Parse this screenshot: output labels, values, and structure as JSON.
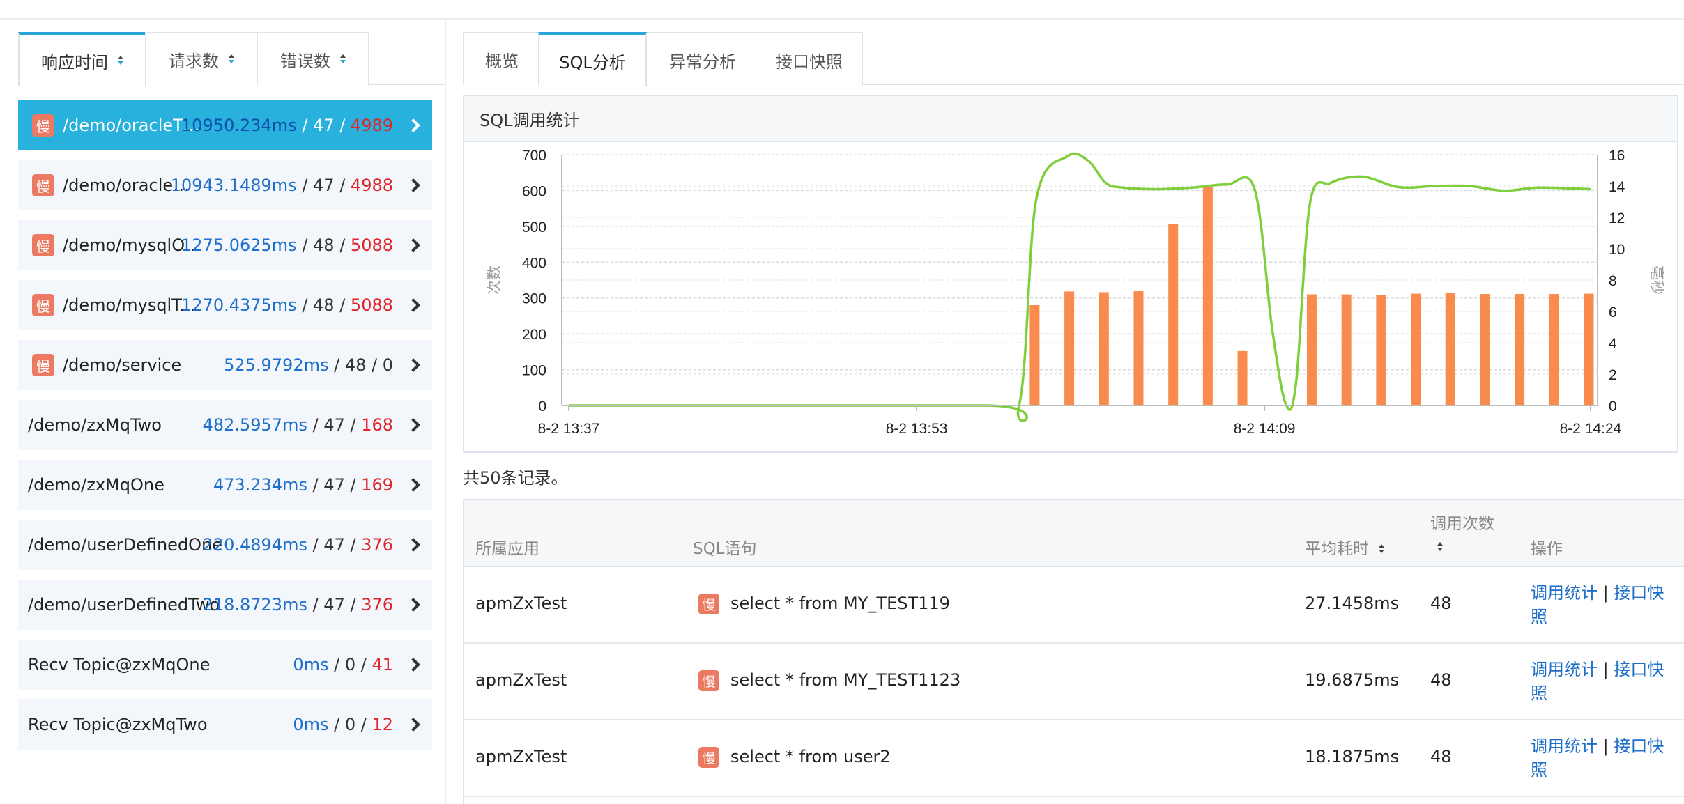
{
  "left_tabs": [
    {
      "label": "响应时间",
      "active": true
    },
    {
      "label": "请求数",
      "active": false
    },
    {
      "label": "错误数",
      "active": false
    }
  ],
  "slow_badge": "慢",
  "endpoints": [
    {
      "name": "/demo/oracleT…",
      "ms": "10950.234ms",
      "count": "47",
      "errors": "4989",
      "slow": true,
      "active": true
    },
    {
      "name": "/demo/oracle…",
      "ms": "10943.1489ms",
      "count": "47",
      "errors": "4988",
      "slow": true,
      "active": false
    },
    {
      "name": "/demo/mysqlO…",
      "ms": "1275.0625ms",
      "count": "48",
      "errors": "5088",
      "slow": true,
      "active": false
    },
    {
      "name": "/demo/mysqlTwo",
      "ms": "1270.4375ms",
      "count": "48",
      "errors": "5088",
      "slow": true,
      "active": false
    },
    {
      "name": "/demo/service",
      "ms": "525.9792ms",
      "count": "48",
      "errors": "0",
      "slow": true,
      "active": false
    },
    {
      "name": "/demo/zxMqTwo",
      "ms": "482.5957ms",
      "count": "47",
      "errors": "168",
      "slow": false,
      "active": false
    },
    {
      "name": "/demo/zxMqOne",
      "ms": "473.234ms",
      "count": "47",
      "errors": "169",
      "slow": false,
      "active": false
    },
    {
      "name": "/demo/userDefinedOne",
      "ms": "220.4894ms",
      "count": "47",
      "errors": "376",
      "slow": false,
      "active": false
    },
    {
      "name": "/demo/userDefinedTwo",
      "ms": "218.8723ms",
      "count": "47",
      "errors": "376",
      "slow": false,
      "active": false
    },
    {
      "name": "Recv Topic@zxMqOne",
      "ms": "0ms",
      "count": "0",
      "errors": "41",
      "slow": false,
      "active": false
    },
    {
      "name": "Recv Topic@zxMqTwo",
      "ms": "0ms",
      "count": "0",
      "errors": "12",
      "slow": false,
      "active": false
    }
  ],
  "right_tabs": [
    {
      "label": "概览",
      "active": false
    },
    {
      "label": "SQL分析",
      "active": true
    },
    {
      "label": "异常分析",
      "active": false
    },
    {
      "label": "接口快照",
      "active": false
    }
  ],
  "chart_panel_title": "SQL调用统计",
  "chart_data": {
    "type": "bar",
    "title": "SQL调用统计",
    "ylabel": "次数",
    "y2label": "毫秒",
    "ylim": [
      0,
      700
    ],
    "y2lim": [
      0,
      16
    ],
    "yticks": [
      0,
      100,
      200,
      300,
      400,
      500,
      600,
      700
    ],
    "y2ticks": [
      0,
      2,
      4,
      6,
      8,
      10,
      12,
      14,
      16
    ],
    "xtick_labels": [
      "8-2 13:37",
      "8-2 13:53",
      "8-2 14:09",
      "8-2 14:24"
    ],
    "grid": true,
    "bar_series": {
      "axis": "left",
      "color": "#f98b4e",
      "x_minutes": [
        13.45,
        14.45,
        15.45,
        16.45,
        17.45,
        18.45,
        19.45,
        21.45,
        22.45,
        23.45,
        24.45,
        25.45,
        26.45,
        27.45,
        28.45,
        29.45
      ],
      "values": [
        280,
        318,
        316,
        320,
        507,
        610,
        152,
        310,
        310,
        308,
        312,
        315,
        311,
        311,
        311,
        312
      ]
    },
    "line_series": {
      "axis": "right",
      "color": "#7fcf3d",
      "x_minutes": [
        0,
        12,
        13.0,
        13.5,
        14.4,
        15.0,
        15.5,
        16.0,
        17.0,
        18.0,
        19.0,
        19.8,
        20.3,
        20.7,
        21.0,
        21.4,
        22.0,
        22.9,
        23.8,
        24.3,
        25.0,
        26.0,
        27.0,
        28.0,
        29.5
      ],
      "values": [
        0,
        0,
        0,
        13.2,
        15.9,
        15.6,
        14.2,
        13.9,
        13.8,
        13.9,
        14.1,
        13.8,
        5.0,
        0.1,
        1.5,
        12.9,
        14.2,
        14.6,
        14.0,
        13.9,
        14.0,
        14.0,
        13.7,
        13.9,
        13.8
      ]
    }
  },
  "total_text": "共50条记录。",
  "table": {
    "headers": {
      "app": "所属应用",
      "sql": "SQL语句",
      "avg": "平均耗时",
      "calls": "调用次数",
      "ops": "操作"
    },
    "op_stats": "调用统计",
    "op_sep": "|",
    "op_snapshot_1": "接口快",
    "op_snapshot_2": "照",
    "rows": [
      {
        "app": "apmZxTest",
        "sql": "select * from MY_TEST119",
        "avg": "27.1458ms",
        "calls": "48"
      },
      {
        "app": "apmZxTest",
        "sql": "select * from MY_TEST1123",
        "avg": "19.6875ms",
        "calls": "48"
      },
      {
        "app": "apmZxTest",
        "sql": "select * from user2",
        "avg": "18.1875ms",
        "calls": "48"
      }
    ]
  }
}
